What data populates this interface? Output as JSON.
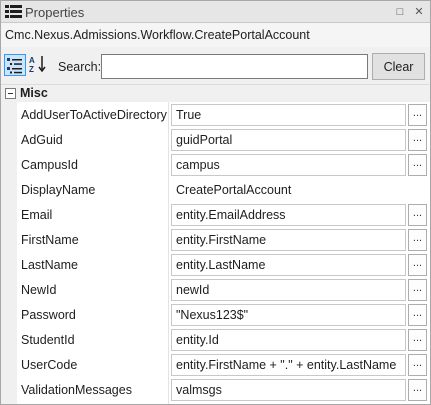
{
  "titlebar": {
    "title": "Properties",
    "title_icon": "properties-list-icon",
    "restore_glyph": "□",
    "close_glyph": "✕"
  },
  "object_name": "Cmc.Nexus.Admissions.Workflow.CreatePortalAccount",
  "toolbar": {
    "categorized_icon": "categorized-view-icon",
    "alphabetical_icon": "sort-alphabetical-icon",
    "search_label": "Search:",
    "search_value": "",
    "clear_label": "Clear"
  },
  "category": {
    "label": "Misc",
    "expanded": true
  },
  "properties": [
    {
      "name": "AddUserToActiveDirectory",
      "value": "True",
      "button": "..."
    },
    {
      "name": "AdGuid",
      "value": "guidPortal",
      "button": "..."
    },
    {
      "name": "CampusId",
      "value": "campus",
      "button": "..."
    },
    {
      "name": "DisplayName",
      "value": "CreatePortalAccount",
      "button": ""
    },
    {
      "name": "Email",
      "value": "entity.EmailAddress",
      "button": "..."
    },
    {
      "name": "FirstName",
      "value": "entity.FirstName",
      "button": "..."
    },
    {
      "name": "LastName",
      "value": "entity.LastName",
      "button": "..."
    },
    {
      "name": "NewId",
      "value": "newId",
      "button": "..."
    },
    {
      "name": "Password",
      "value": "\"Nexus123$\"",
      "button": "..."
    },
    {
      "name": "StudentId",
      "value": "entity.Id",
      "button": "..."
    },
    {
      "name": "UserCode",
      "value": "entity.FirstName + \".\" + entity.LastName",
      "button": "..."
    },
    {
      "name": "ValidationMessages",
      "value": "valmsgs",
      "button": "..."
    }
  ],
  "colors": {
    "accent": "#3399ff",
    "selected_bg": "#cce4f7",
    "chrome_bg": "#f0f0f0"
  }
}
